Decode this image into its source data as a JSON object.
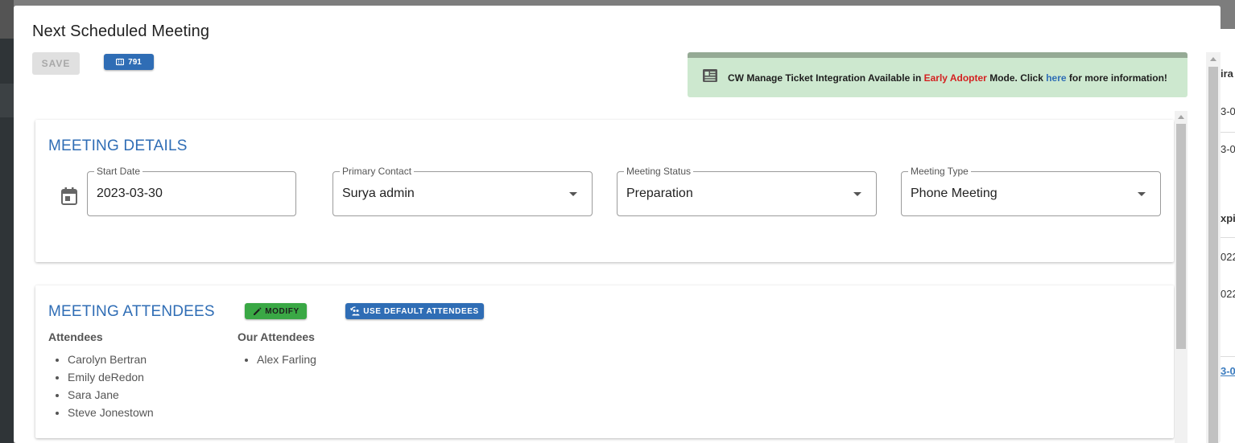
{
  "modal": {
    "title": "Next Scheduled Meeting",
    "save_label": "SAVE",
    "ticket_count": "791"
  },
  "banner": {
    "text_before": "CW Manage Ticket Integration Available in ",
    "highlight": "Early Adopter",
    "text_middle": " Mode. Click ",
    "link_text": "here",
    "text_after": " for more information!"
  },
  "meeting_details": {
    "title": "MEETING DETAILS",
    "start_date": {
      "label": "Start Date",
      "value": "2023-03-30"
    },
    "primary_contact": {
      "label": "Primary Contact",
      "value": "Surya admin"
    },
    "meeting_status": {
      "label": "Meeting Status",
      "value": "Preparation"
    },
    "meeting_type": {
      "label": "Meeting Type",
      "value": "Phone Meeting"
    }
  },
  "meeting_attendees": {
    "title": "MEETING ATTENDEES",
    "modify_label": "MODIFY",
    "default_label": "USE DEFAULT ATTENDEES",
    "attendees_header": "Attendees",
    "attendees": [
      "Carolyn Bertran",
      "Emily deRedon",
      "Sara Jane",
      "Steve Jonestown"
    ],
    "our_attendees_header": "Our Attendees",
    "our_attendees": [
      "Alex Farling"
    ]
  },
  "background": {
    "fragments": [
      "ira",
      "3-0",
      "3-0",
      "xpi",
      "022",
      "022",
      "3-0"
    ]
  },
  "colors": {
    "primary_blue": "#2f6db5",
    "modify_green": "#3aa845",
    "banner_green": "#cde8cf",
    "early_adopter_red": "#d42121"
  }
}
